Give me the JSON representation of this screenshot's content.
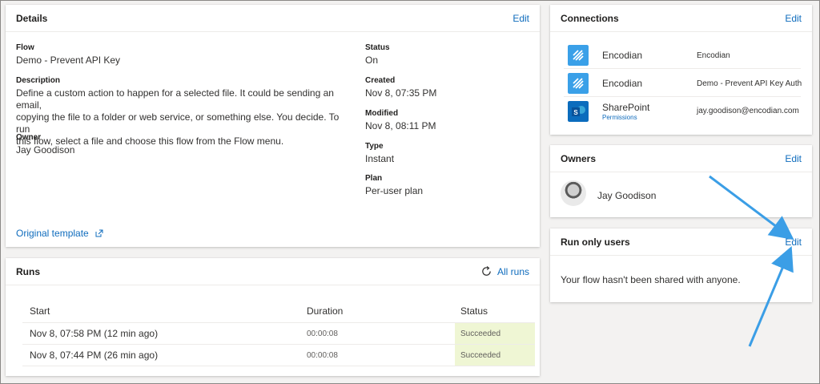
{
  "details": {
    "title": "Details",
    "edit_label": "Edit",
    "flow_label": "Flow",
    "flow_value": "Demo - Prevent API Key",
    "description_label": "Description",
    "description_lines": [
      "Define a custom action to happen for a selected file. It could be sending an email,",
      "copying the file to a folder or web service, or something else. You decide. To run",
      "this flow, select a file and choose this flow from the Flow menu."
    ],
    "owner_label": "Owner",
    "owner_value": "Jay Goodison",
    "status_label": "Status",
    "status_value": "On",
    "created_label": "Created",
    "created_value": "Nov 8, 07:35 PM",
    "modified_label": "Modified",
    "modified_value": "Nov 8, 08:11 PM",
    "type_label": "Type",
    "type_value": "Instant",
    "plan_label": "Plan",
    "plan_value": "Per-user plan",
    "template_link": "Original template"
  },
  "runs": {
    "title": "Runs",
    "all_runs_label": "All runs",
    "columns": [
      "Start",
      "Duration",
      "Status"
    ],
    "rows": [
      {
        "start": "Nov 8, 07:58 PM (12 min ago)",
        "duration": "00:00:08",
        "status": "Succeeded"
      },
      {
        "start": "Nov 8, 07:44 PM (26 min ago)",
        "duration": "00:00:08",
        "status": "Succeeded"
      }
    ]
  },
  "connections": {
    "title": "Connections",
    "edit_label": "Edit",
    "items": [
      {
        "name": "Encodian",
        "account": "Encodian",
        "icon": "encodian-icon",
        "color": "#3aa0e8"
      },
      {
        "name": "Encodian",
        "account": "Demo - Prevent API Key Auth",
        "icon": "encodian-icon",
        "color": "#3aa0e8"
      },
      {
        "name": "SharePoint",
        "sub": "Permissions",
        "account": "jay.goodison@encodian.com",
        "icon": "sharepoint-icon",
        "color": "#0b6cbd"
      }
    ]
  },
  "owners": {
    "title": "Owners",
    "edit_label": "Edit",
    "name": "Jay Goodison"
  },
  "run_only": {
    "title": "Run only users",
    "edit_label": "Edit",
    "message": "Your flow hasn't been shared with anyone."
  },
  "colors": {
    "link": "#0f6cbd",
    "annotation_arrow": "#3b9ee6",
    "success_bg": "#eff6d4"
  }
}
